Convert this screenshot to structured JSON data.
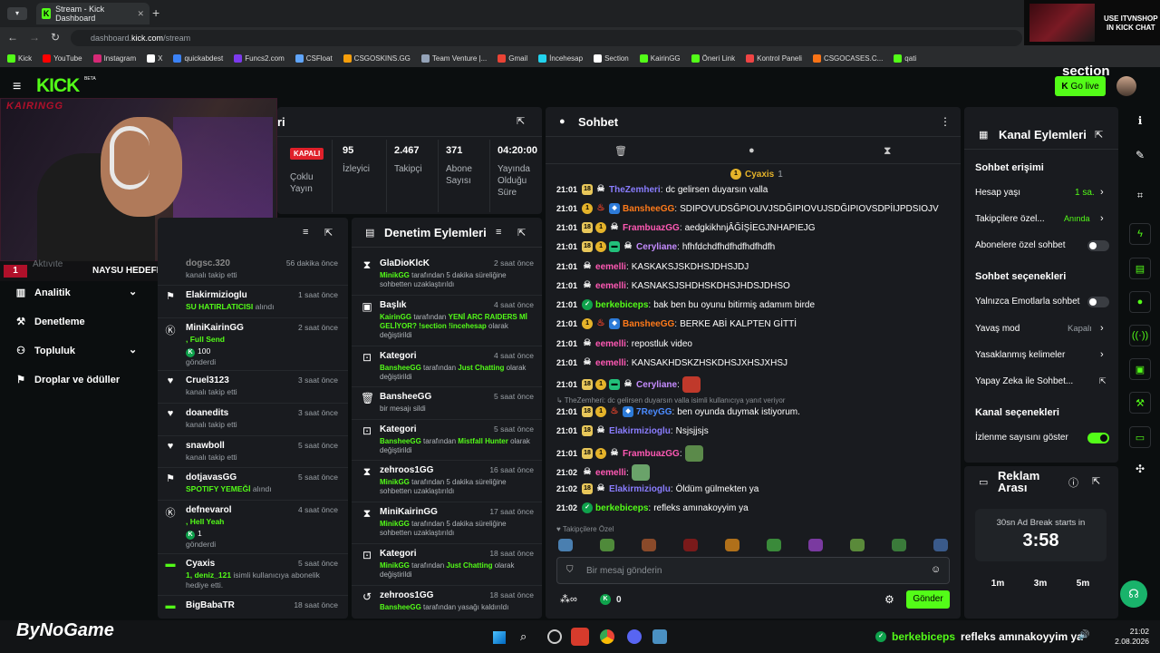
{
  "browser": {
    "tab_title": "Stream - Kick Dashboard",
    "url_prefix": "dashboard.",
    "url_domain": "kick.com",
    "url_path": "/stream",
    "bookmarks": [
      "Kick",
      "YouTube",
      "Instagram",
      "X",
      "quickabdest",
      "Funcs2.com",
      "CSFloat",
      "CSGOSKINS.GG",
      "Team Venture |...",
      "Gmail",
      "İncehesap",
      "Section",
      "KairinGG",
      "Öneri Link",
      "Kontrol Paneli",
      "CSGOCASES.C...",
      "qati"
    ],
    "bookmark_colors": [
      "#53fc18",
      "#ff0000",
      "#d62976",
      "#ffffff",
      "#3b82f6",
      "#7c3aed",
      "#60a5fa",
      "#f59e0b",
      "#94a3b8",
      "#ea4335",
      "#22d3ee",
      "#ffffff",
      "#53fc18",
      "#53fc18",
      "#ef4444",
      "#f97316",
      "#53fc18"
    ]
  },
  "header": {
    "logo": "KICK",
    "beta": "BETA",
    "go_live": "Go live",
    "section_logo": "section"
  },
  "overlay": {
    "promo_line1": "USE ITVNSHOP",
    "promo_line2": "IN KICK CHAT",
    "streamer_tag": "KAIRINGG",
    "goal_label": "NAYSU HEDEFLER",
    "goal_count": "10",
    "goal_left": "1",
    "bynogame": "ByNoGame",
    "ticker_user": "berkebiceps",
    "ticker_msg": "refleks amınakoyyim ya"
  },
  "sidebar": {
    "partial_item": "Aktıvıte",
    "items": [
      {
        "label": "Analitik",
        "icon": "chart-icon",
        "chevron": true
      },
      {
        "label": "Denetleme",
        "icon": "wrench-icon",
        "chevron": false
      },
      {
        "label": "Topluluk",
        "icon": "users-icon",
        "chevron": true
      },
      {
        "label": "Droplar ve ödüller",
        "icon": "gift-icon",
        "chevron": false
      }
    ]
  },
  "stream_info": {
    "title_fragment": "ri",
    "status": "KAPALI",
    "mode": "Çoklu Yayın",
    "stats": [
      {
        "value": "95",
        "label": "İzleyici"
      },
      {
        "value": "2.467",
        "label": "Takipçi"
      },
      {
        "value": "371",
        "label": "Abone Sayısı"
      },
      {
        "value": "04:20:00",
        "label": "Yayında Olduğu Süre"
      }
    ]
  },
  "activity": {
    "partial_top": {
      "name": "dogsc.320",
      "time": "56 dakika önce",
      "sub": "kanalı takip etti"
    },
    "items": [
      {
        "icon": "gift-icon",
        "name": "Elakirmizioglu",
        "time": "1 saat önce",
        "sub": "SU HATIRLATICISI",
        "sub2": " alındı",
        "green": true
      },
      {
        "icon": "kick-icon",
        "name": "MiniKairinGG",
        "time": "2 saat önce",
        "sub": ", Full Send",
        "sub2": "100",
        "sub3": "gönderdi",
        "green": true
      },
      {
        "icon": "heart-icon",
        "name": "Cruel3123",
        "time": "3 saat önce",
        "sub": "kanalı takip etti"
      },
      {
        "icon": "heart-icon",
        "name": "doanedits",
        "time": "3 saat önce",
        "sub": "kanalı takip etti"
      },
      {
        "icon": "heart-icon",
        "name": "snawboll",
        "time": "5 saat önce",
        "sub": "kanalı takip etti"
      },
      {
        "icon": "gift-icon",
        "name": "dotjavasGG",
        "time": "5 saat önce",
        "sub": "SPOTIFY YEMEĞİ",
        "sub2": " alındı",
        "green": true
      },
      {
        "icon": "kick-icon",
        "name": "defnevarol",
        "time": "4 saat önce",
        "sub": ", Hell Yeah",
        "sub2": "1",
        "sub3": "gönderdi",
        "green": true
      },
      {
        "icon": "gift-sub-icon",
        "name": "Cyaxis",
        "time": "5 saat önce",
        "sub": "1, deniz_121",
        "sub2": " isimli kullanıcıya abonelik hediye etti.",
        "green": true
      },
      {
        "icon": "gift-sub-icon",
        "name": "BigBabaTR",
        "time": "18 saat önce",
        "sub": ""
      }
    ]
  },
  "moderation": {
    "title": "Denetim Eylemleri",
    "items": [
      {
        "icon": "hourglass-icon",
        "name": "GlaDioKlcK",
        "time": "2 saat önce",
        "actor": "MinikGG",
        "text": " tarafından 5 dakika süreliğine sohbetten uzaklaştırıldı"
      },
      {
        "icon": "edit-title-icon",
        "name": "Başlık",
        "time": "4 saat önce",
        "actor": "KairinGG",
        "text": " tarafından ",
        "hl": "YENİ ARC RAIDERS Mİ GELİYOR? !section !incehesap",
        "text2": " olarak değiştirildi"
      },
      {
        "icon": "category-icon",
        "name": "Kategori",
        "time": "4 saat önce",
        "actor": "BansheeGG",
        "text": " tarafından ",
        "hl": "Just Chatting",
        "text2": " olarak değiştirildi"
      },
      {
        "icon": "trash-icon",
        "name": "BansheeGG",
        "time": "5 saat önce",
        "actor": "",
        "text": "bir mesajı sildi"
      },
      {
        "icon": "category-icon",
        "name": "Kategori",
        "time": "5 saat önce",
        "actor": "BansheeGG",
        "text": " tarafından ",
        "hl": "Mistfall Hunter",
        "text2": " olarak değiştirildi"
      },
      {
        "icon": "hourglass-icon",
        "name": "zehroos1GG",
        "time": "16 saat önce",
        "actor": "MinikGG",
        "text": " tarafından 5 dakika süreliğine sohbetten uzaklaştırıldı"
      },
      {
        "icon": "hourglass-icon",
        "name": "MiniKairinGG",
        "time": "17 saat önce",
        "actor": "MinikGG",
        "text": " tarafından 5 dakika süreliğine sohbetten uzaklaştırıldı"
      },
      {
        "icon": "category-icon",
        "name": "Kategori",
        "time": "18 saat önce",
        "actor": "MinikGG",
        "text": " tarafından ",
        "hl": "Just Chatting",
        "text2": " olarak değiştirildi"
      },
      {
        "icon": "unban-icon",
        "name": "zehroos1GG",
        "time": "18 saat önce",
        "actor": "BansheeGG",
        "text": " tarafından yasağı kaldırıldı"
      }
    ]
  },
  "chat": {
    "title": "Sohbet",
    "pinned_user": "Cyaxis",
    "pinned_count": "1",
    "reply_context": "TheZemheri: dc gelirsen duyarsın valla isimli kullanıcıya yanıt veriyor",
    "followers_only": "Takipçilere Özel",
    "input_placeholder": "Bir mesaj gönderin",
    "send": "Gönder",
    "points": "0",
    "messages": [
      {
        "time": "21:01",
        "badges": [
          "sub",
          "skull"
        ],
        "user": "TheZemheri",
        "color": "#8a7dff",
        "text": "dc gelirsen duyarsın valla"
      },
      {
        "time": "21:01",
        "badges": [
          "gold",
          "red",
          "vip"
        ],
        "user": "BansheeGG",
        "color": "#ff7a1a",
        "text": "SDIPOVUDSĞPIOUVJSDĞIPIOVUJSDĞIPIOVSDPİIJPDSIOJV"
      },
      {
        "time": "21:01",
        "badges": [
          "sub",
          "gold",
          "skull"
        ],
        "user": "FrambuazGG",
        "color": "#ff59b4",
        "text": "aedgkikhnjÂĞİŞİEGJNHAPIEJG"
      },
      {
        "time": "21:01",
        "badges": [
          "sub",
          "gold",
          "green",
          "skull"
        ],
        "user": "Ceryliane",
        "color": "#c58cff",
        "text": "hfhfdchdfhdfhdfhdfhdfh"
      },
      {
        "time": "21:01",
        "badges": [
          "skull"
        ],
        "user": "eemelli",
        "color": "#ff59b4",
        "text": "KASKAKSJSKDHSJDHSJDJ"
      },
      {
        "time": "21:01",
        "badges": [
          "skull"
        ],
        "user": "eemelli",
        "color": "#ff59b4",
        "text": "KASNAKSJSHDHSKDHSJHDSJDHSO"
      },
      {
        "time": "21:01",
        "badges": [
          "verified"
        ],
        "user": "berkebiceps",
        "color": "#53fc18",
        "text": "bak ben bu oyunu bitirmiş adamım birde"
      },
      {
        "time": "21:01",
        "badges": [
          "gold",
          "red",
          "vip"
        ],
        "user": "BansheeGG",
        "color": "#ff7a1a",
        "text": "BERKE ABİ KALPTEN GİTTİ"
      },
      {
        "time": "21:01",
        "badges": [
          "skull"
        ],
        "user": "eemelli",
        "color": "#ff59b4",
        "text": "repostluk video"
      },
      {
        "time": "21:01",
        "badges": [
          "skull"
        ],
        "user": "eemelli",
        "color": "#ff59b4",
        "text": "KANSAKHDSKZHSKDHSJXHSJXHSJ"
      },
      {
        "time": "21:01",
        "badges": [
          "sub",
          "gold",
          "green",
          "skull"
        ],
        "user": "Ceryliane",
        "color": "#c58cff",
        "text": "",
        "emote": "#c0392b"
      },
      {
        "time": "21:01",
        "badges": [
          "sub",
          "gold",
          "red",
          "vip"
        ],
        "user": "7ReyGG",
        "color": "#4b8bff",
        "text": "ben oyunda duymak istiyorum.",
        "reply": true
      },
      {
        "time": "21:01",
        "badges": [
          "sub",
          "skull"
        ],
        "user": "Elakirmizioglu",
        "color": "#8a7dff",
        "text": "Nsjsjjsjs"
      },
      {
        "time": "21:01",
        "badges": [
          "sub",
          "gold",
          "skull"
        ],
        "user": "FrambuazGG",
        "color": "#ff59b4",
        "text": "",
        "emote": "#5b8a4a"
      },
      {
        "time": "21:02",
        "badges": [
          "skull"
        ],
        "user": "eemelli",
        "color": "#ff59b4",
        "text": "",
        "emote": "#6aa36a"
      },
      {
        "time": "21:02",
        "badges": [
          "sub",
          "skull"
        ],
        "user": "Elakirmizioglu",
        "color": "#8a7dff",
        "text": "Öldüm gülmekten ya"
      },
      {
        "time": "21:02",
        "badges": [
          "verified"
        ],
        "user": "berkebiceps",
        "color": "#53fc18",
        "text": "refleks amınakoyyim ya"
      }
    ],
    "emote_row": [
      "#4a7fb0",
      "#4f8a3a",
      "#8a4a2a",
      "#7a1a1a",
      "#b0701a",
      "#3a8a3a",
      "#7a3aa0",
      "#5a8a3a",
      "#3a7a3a",
      "#3a5a8a"
    ]
  },
  "channel_actions": {
    "title": "Kanal Eylemleri",
    "chat_access": "Sohbet erişimi",
    "account_age": {
      "label": "Hesap yaşı",
      "value": "1 sa."
    },
    "followers_only": {
      "label": "Takipçilere özel...",
      "value": "Anında"
    },
    "subs_only": {
      "label": "Abonelere özel sohbet"
    },
    "chat_options": "Sohbet seçenekleri",
    "emote_only": {
      "label": "Yalnızca Emotlarla sohbet"
    },
    "slow_mode": {
      "label": "Yavaş mod",
      "value": "Kapalı"
    },
    "banned_words": {
      "label": "Yasaklanmış kelimeler"
    },
    "ai_chat": {
      "label": "Yapay Zeka ile Sohbet..."
    },
    "channel_options": "Kanal seçenekleri",
    "show_viewers": {
      "label": "İzlenme sayısını göster",
      "on": true
    }
  },
  "ad_break": {
    "title_line1": "Reklam",
    "title_line2": "Arası",
    "starts_in": "30sn Ad Break starts in",
    "countdown": "3:58",
    "options": [
      "1m",
      "3m",
      "5m"
    ]
  },
  "taskbar": {
    "clock": "21:02",
    "date": "2.08.2026"
  }
}
